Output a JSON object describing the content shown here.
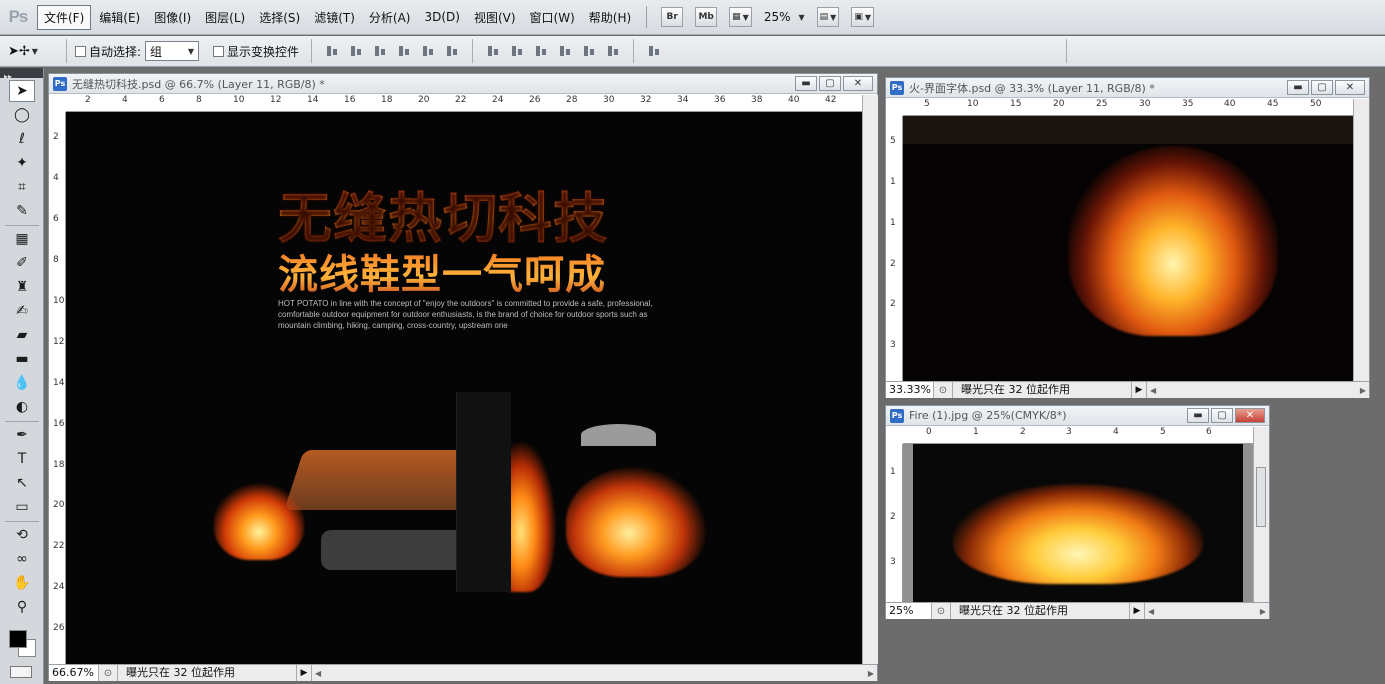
{
  "app": {
    "logo": "Ps"
  },
  "menu": {
    "items": [
      "文件(F)",
      "编辑(E)",
      "图像(I)",
      "图层(L)",
      "选择(S)",
      "滤镜(T)",
      "分析(A)",
      "3D(D)",
      "视图(V)",
      "窗口(W)",
      "帮助(H)"
    ],
    "bridge_label": "Br",
    "minibridge_label": "Mb",
    "zoom_value": "25%"
  },
  "options": {
    "auto_select_label": "自动选择:",
    "auto_select_value": "组",
    "show_transform_label": "显示变换控件"
  },
  "windows": [
    {
      "title": "无缝热切科技.psd @ 66.7% (Layer 11, RGB/8) *",
      "status_zoom": "66.67%",
      "status_text": "曝光只在 32 位起作用",
      "ruler_h": [
        "2",
        "4",
        "6",
        "8",
        "10",
        "12",
        "14",
        "16",
        "18",
        "20",
        "22",
        "24",
        "26",
        "28",
        "30",
        "32",
        "34",
        "36",
        "38",
        "40",
        "42"
      ],
      "ruler_v": [
        "2",
        "4",
        "6",
        "8",
        "10",
        "12",
        "14",
        "16",
        "18",
        "20",
        "22",
        "24",
        "26"
      ],
      "artwork": {
        "headline1": "无缝热切科技",
        "headline2": "流线鞋型一气呵成",
        "tagline": "HOT POTATO in line with the concept of \"enjoy the outdoors\" is committed to provide a safe, professional, comfortable outdoor equipment for outdoor enthusiasts, is the brand of choice for outdoor sports such as mountain climbing, hiking, camping, cross-country, upstream one"
      }
    },
    {
      "title": "火-界面字体.psd @ 33.3% (Layer 11, RGB/8) *",
      "status_zoom": "33.33%",
      "status_text": "曝光只在 32 位起作用",
      "ruler_h": [
        "5",
        "10",
        "15",
        "20",
        "25",
        "30",
        "35",
        "40",
        "45",
        "50"
      ],
      "ruler_v": [
        "5",
        "1",
        "1",
        "2",
        "2",
        "3"
      ]
    },
    {
      "title": "Fire (1).jpg @ 25%(CMYK/8*)",
      "status_zoom": "25%",
      "status_text": "曝光只在 32 位起作用",
      "ruler_h": [
        "0",
        "1",
        "2",
        "3",
        "4",
        "5",
        "6"
      ],
      "ruler_v": [
        "1",
        "2",
        "3"
      ]
    }
  ],
  "tools": [
    "move-tool",
    "marquee-tool",
    "lasso-tool",
    "quick-select-tool",
    "crop-tool",
    "eyedropper-tool",
    "healing-brush-tool",
    "brush-tool",
    "clone-stamp-tool",
    "history-brush-tool",
    "eraser-tool",
    "gradient-tool",
    "blur-tool",
    "dodge-tool",
    "pen-tool",
    "type-tool",
    "path-select-tool",
    "shape-tool",
    "3d-rotate-tool",
    "3d-orbit-tool",
    "hand-tool",
    "zoom-tool"
  ]
}
